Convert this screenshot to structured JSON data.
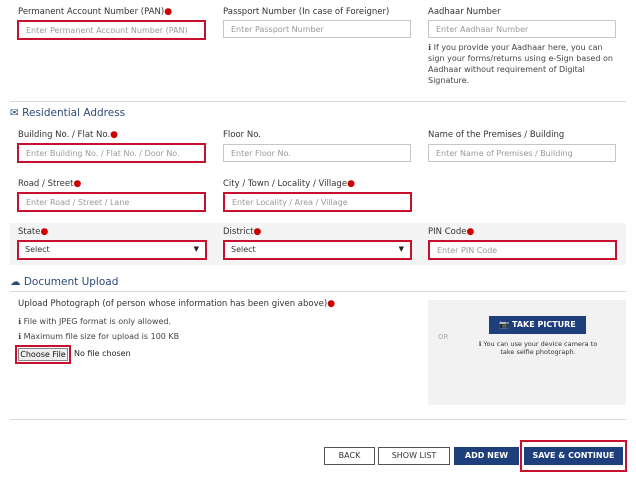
{
  "pan": {
    "label": "Permanent Account Number (PAN)",
    "placeholder": "Enter Permanent Account Number (PAN)"
  },
  "passport": {
    "label": "Passport Number (In case of Foreigner)",
    "placeholder": "Enter Passport Number"
  },
  "aadhaar": {
    "label": "Aadhaar Number",
    "placeholder": "Enter Aadhaar Number",
    "help_lines": [
      "If you provide your Aadhaar here, you can",
      "sign your forms/returns using e-Sign based on",
      "Aadhaar without requirement of Digital",
      "Signature."
    ]
  },
  "residential": {
    "title": "Residential Address",
    "building": {
      "label": "Building No. / Flat No.",
      "placeholder": "Enter Building No. / Flat No. / Door No."
    },
    "floor": {
      "label": "Floor No.",
      "placeholder": "Enter Floor No."
    },
    "premises": {
      "label": "Name of the Premises / Building",
      "placeholder": "Enter Name of Premises / Building"
    },
    "road": {
      "label": "Road / Street",
      "placeholder": "Enter Road / Street / Lane"
    },
    "city": {
      "label": "City / Town / Locality / Village",
      "placeholder": "Enter Locality / Area / Village"
    },
    "state": {
      "label": "State",
      "value": "Select"
    },
    "district": {
      "label": "District",
      "value": "Select"
    },
    "pin": {
      "label": "PIN Code",
      "placeholder": "Enter PIN Code"
    }
  },
  "document": {
    "title": "Document Upload",
    "photo_label": "Upload Photograph (of person whose information has been given above)",
    "info1": "File with JPEG format is only allowed.",
    "info2": "Maximum file size for upload is 100 KB",
    "choose_file": "Choose File",
    "no_file": "No file chosen",
    "or": "OR",
    "take_picture": "TAKE PICTURE",
    "camera_help": [
      "You can use your device camera to",
      "take selfie photograph."
    ]
  },
  "buttons": {
    "back": "BACK",
    "show_list": "SHOW LIST",
    "add_new": "ADD NEW",
    "save_continue": "SAVE & CONTINUE"
  },
  "colors": {
    "error_border": "#c8102e",
    "primary": "#1f3f7c",
    "required": "#cc0000"
  }
}
